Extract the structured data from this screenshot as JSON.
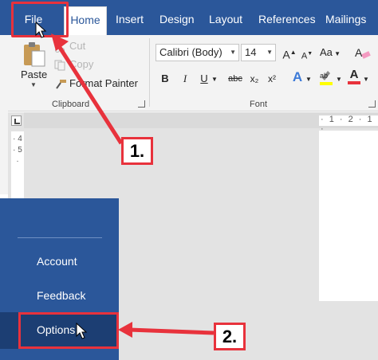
{
  "tabs": {
    "file": "File",
    "home": "Home",
    "insert": "Insert",
    "design": "Design",
    "layout": "Layout",
    "references": "References",
    "mailings": "Mailings"
  },
  "clipboard": {
    "paste": "Paste",
    "cut": "Cut",
    "copy": "Copy",
    "format_painter": "Format Painter",
    "group_label": "Clipboard"
  },
  "font": {
    "name": "Calibri (Body)",
    "size": "14",
    "bold": "B",
    "italic": "I",
    "underline": "U",
    "strike": "abc",
    "subscript": "x₂",
    "superscript": "x²",
    "text_effects": "A",
    "font_color": "A",
    "case": "Aa",
    "grow": "A",
    "shrink": "A",
    "group_label": "Font"
  },
  "ruler": {
    "top": "· 1 · 2 · 1 ·",
    "left": "· 4 · 5 ·"
  },
  "backstage": {
    "account": "Account",
    "feedback": "Feedback",
    "options": "Options"
  },
  "callouts": {
    "step1": "1.",
    "step2": "2."
  },
  "colors": {
    "word_blue": "#2b579a",
    "selected_dark": "#1c3e73",
    "annotation_red": "#e8323c",
    "highlight_yellow": "#ffff00",
    "font_color_red": "#e8323c"
  }
}
